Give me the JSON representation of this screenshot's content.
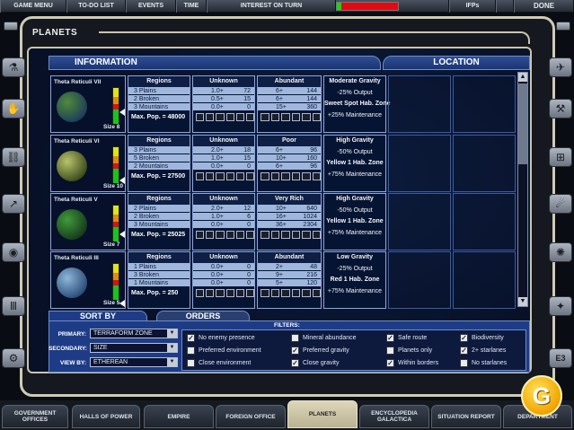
{
  "topbar": {
    "items": [
      "GAME MENU",
      "TO-DO LIST",
      "EVENTS",
      "TIME",
      "INTEREST ON TURN",
      "IFPs",
      "DONE"
    ],
    "interest_fill": 0.08
  },
  "page": {
    "title": "PLANETS"
  },
  "headers": {
    "information": "INFORMATION",
    "location": "LOCATION"
  },
  "columns": {
    "regions": "Regions"
  },
  "planets": [
    {
      "name": "Theta Reticuli VII",
      "size": "Size 8",
      "max_pop": "Max. Pop. = 48000",
      "col2_header": "Unknown",
      "col3_header": "Abundant",
      "regions": [
        {
          "label": "3 Plains",
          "a": "1.0+",
          "b": "72",
          "c": "6+",
          "d": "144"
        },
        {
          "label": "2 Broken",
          "a": "0.5+",
          "b": "15",
          "c": "6+",
          "d": "144"
        },
        {
          "label": "3 Mountains",
          "a": "0.0+",
          "b": "0",
          "c": "15+",
          "d": "360"
        }
      ],
      "attrs": [
        "Moderate Gravity",
        "-25% Output",
        "Sweet Spot Hab. Zone",
        "+25% Maintenance"
      ],
      "globe": [
        "#4f8a3a",
        "#1d3d5a"
      ],
      "gauge_level": 0.62
    },
    {
      "name": "Theta Reticuli VI",
      "size": "Size 10",
      "max_pop": "Max. Pop. = 27500",
      "col2_header": "Unknown",
      "col3_header": "Poor",
      "regions": [
        {
          "label": "3 Plains",
          "a": "2.0+",
          "b": "18",
          "c": "6+",
          "d": "96"
        },
        {
          "label": "5 Broken",
          "a": "1.0+",
          "b": "15",
          "c": "10+",
          "d": "160"
        },
        {
          "label": "2 Mountains",
          "a": "0.0+",
          "b": "0",
          "c": "6+",
          "d": "96"
        }
      ],
      "attrs": [
        "High Gravity",
        "-50% Output",
        "Yellow 1 Hab. Zone",
        "+75% Maintenance"
      ],
      "globe": [
        "#b8c46a",
        "#3c4a1c"
      ],
      "gauge_level": 0.38
    },
    {
      "name": "Theta Reticuli V",
      "size": "Size 7",
      "max_pop": "Max. Pop. = 25025",
      "col2_header": "Unknown",
      "col3_header": "Very Rich",
      "regions": [
        {
          "label": "2 Plains",
          "a": "2.0+",
          "b": "12",
          "c": "10+",
          "d": "640"
        },
        {
          "label": "2 Broken",
          "a": "1.0+",
          "b": "6",
          "c": "16+",
          "d": "1024"
        },
        {
          "label": "3 Mountains",
          "a": "0.0+",
          "b": "0",
          "c": "36+",
          "d": "2304"
        }
      ],
      "attrs": [
        "High Gravity",
        "-50% Output",
        "Yellow 1 Hab. Zone",
        "+75% Maintenance"
      ],
      "globe": [
        "#3f9a3a",
        "#173a1c"
      ],
      "gauge_level": 0.5
    },
    {
      "name": "Theta Reticuli III",
      "size": "Size 5",
      "max_pop": "Max. Pop. = 250",
      "col2_header": "Unknown",
      "col3_header": "Abundant",
      "regions": [
        {
          "label": "1 Plains",
          "a": "0.0+",
          "b": "0",
          "c": "2+",
          "d": "48"
        },
        {
          "label": "3 Broken",
          "a": "0.0+",
          "b": "0",
          "c": "9+",
          "d": "216"
        },
        {
          "label": "1 Mountains",
          "a": "0.0+",
          "b": "0",
          "c": "5+",
          "d": "120"
        }
      ],
      "attrs": [
        "Low Gravity",
        "-25% Output",
        "Red 1 Hab. Zone",
        "+75% Maintenance"
      ],
      "globe": [
        "#8fb6d8",
        "#2b4c7a"
      ],
      "gauge_level": 0.2
    }
  ],
  "sort": {
    "tab_sort": "SORT BY",
    "tab_orders": "ORDERS",
    "primary_label": "PRIMARY:",
    "primary_value": "TERRAFORM ZONE",
    "secondary_label": "SECONDARY:",
    "secondary_value": "SIZE",
    "viewby_label": "VIEW BY:",
    "viewby_value": "ETHEREAN"
  },
  "filters": {
    "label": "FILTERS:",
    "items": [
      {
        "label": "No enemy presence",
        "checked": true
      },
      {
        "label": "Preferred environment",
        "checked": false
      },
      {
        "label": "Close environment",
        "checked": false
      },
      {
        "label": "Mineral abundance",
        "checked": false
      },
      {
        "label": "Preferred gravity",
        "checked": true
      },
      {
        "label": "Close gravity",
        "checked": true
      },
      {
        "label": "Safe route",
        "checked": true
      },
      {
        "label": "Planets only",
        "checked": false
      },
      {
        "label": "Within borders",
        "checked": true
      },
      {
        "label": "Biodiversity",
        "checked": true
      },
      {
        "label": "2+ starlanes",
        "checked": true
      },
      {
        "label": "No starlanes",
        "checked": false
      }
    ]
  },
  "bottom_nav": [
    "GOVERNMENT OFFICES",
    "HALLS OF POWER",
    "EMPIRE",
    "FOREIGN OFFICE",
    "PLANETS",
    "ENCYCLOPEDIA GALACTICA",
    "SITUATION REPORT",
    "DEPARTMENT"
  ],
  "side": {
    "e3_label": "E3"
  },
  "logo": {
    "text": "G"
  }
}
